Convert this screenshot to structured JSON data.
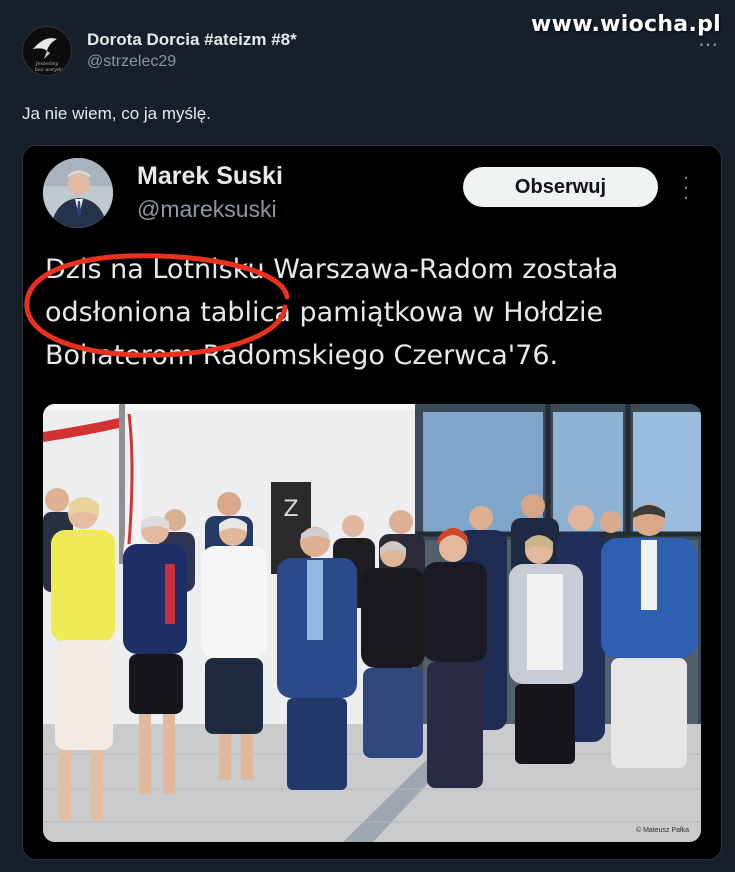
{
  "watermark": "www.wiocha.pl",
  "outer_tweet": {
    "author_name": "Dorota Dorcia #ateizm #8*",
    "author_handle": "@strzelec29",
    "text": "Ja nie wiem, co ja myślę.",
    "more_icon": "more-horizontal-icon"
  },
  "quoted_tweet": {
    "author_name": "Marek Suski",
    "author_handle": "@mareksuski",
    "follow_label": "Obserwuj",
    "text_lines": [
      "Dziś na Lotnisku Warszawa-Radom została",
      "odsłoniona tablica pamiątkowa w Hołdzie",
      "Bohaterom Radomskiego Czerwca'76."
    ],
    "photo_credit": "© Mateusz Pałka",
    "annotation_color": "#e8321e"
  }
}
